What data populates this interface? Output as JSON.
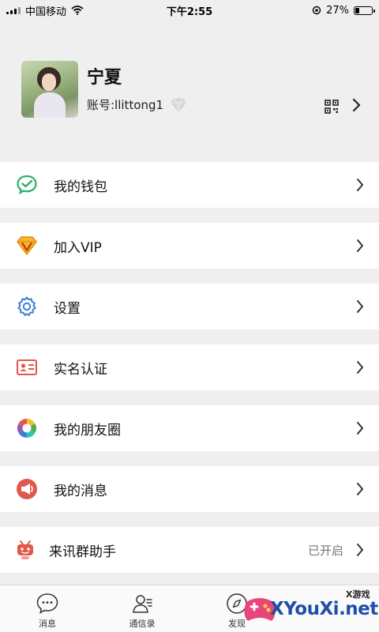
{
  "status_bar": {
    "carrier": "中国移动",
    "time": "下午2:55",
    "battery_percent": "27%",
    "battery_level": 0.27
  },
  "profile": {
    "name": "宁夏",
    "account": "账号:llittong1"
  },
  "menu": [
    {
      "label": "我的钱包",
      "icon": "wallet-icon"
    },
    {
      "label": "加入VIP",
      "icon": "vip-diamond-icon"
    },
    {
      "label": "设置",
      "icon": "settings-gear-icon"
    },
    {
      "label": "实名认证",
      "icon": "id-card-icon"
    },
    {
      "label": "我的朋友圈",
      "icon": "moments-aperture-icon"
    },
    {
      "label": "我的消息",
      "icon": "message-horn-icon"
    },
    {
      "label": "来讯群助手",
      "icon": "robot-assistant-icon",
      "value": "已开启"
    }
  ],
  "tabs": [
    {
      "label": "消息",
      "icon": "chat-bubble-icon"
    },
    {
      "label": "通信录",
      "icon": "contacts-icon"
    },
    {
      "label": "发现",
      "icon": "compass-icon"
    }
  ],
  "watermark": {
    "small": "X游戏",
    "text": "XYouXi.net"
  },
  "colors": {
    "background": "#efefef",
    "card": "#ffffff",
    "wallet_green": "#2aae67",
    "vip_orange": "#f3a21b",
    "settings_blue": "#3a7fd5",
    "id_red": "#e2574c",
    "watermark_blue": "#1e4ea8"
  }
}
